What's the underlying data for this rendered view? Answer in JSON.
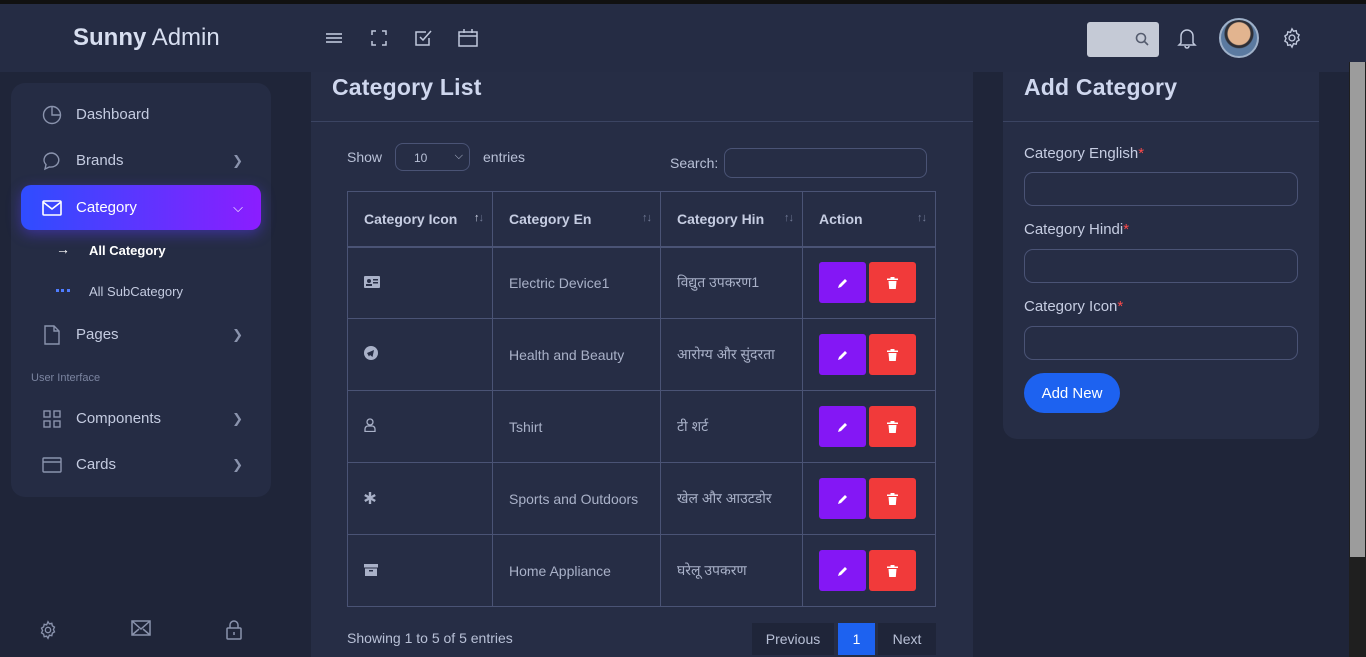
{
  "header": {
    "brand_bold": "Sunny",
    "brand_rest": "Admin"
  },
  "sidebar": {
    "items": [
      {
        "label": "Dashboard",
        "icon": "pie-chart-icon"
      },
      {
        "label": "Brands",
        "icon": "chat-icon"
      },
      {
        "label": "Category",
        "icon": "mail-icon"
      },
      {
        "label": "Pages",
        "icon": "file-icon"
      },
      {
        "label": "Components",
        "icon": "grid-icon"
      },
      {
        "label": "Cards",
        "icon": "card-icon"
      }
    ],
    "sub_items": [
      "All Category",
      "All SubCategory"
    ],
    "caption": "User Interface"
  },
  "list_panel": {
    "title": "Category List",
    "show_label": "Show",
    "entries_value": "10",
    "entries_label": "entries",
    "search_label": "Search:",
    "columns": [
      "Category Icon",
      "Category En",
      "Category Hin",
      "Action"
    ],
    "rows": [
      {
        "icon": "id-card-icon",
        "en": "Electric Device1",
        "hin": "विद्युत उपकरण1"
      },
      {
        "icon": "telegram-icon",
        "en": "Health and Beauty",
        "hin": "आरोग्य और सुंदरता"
      },
      {
        "icon": "user-icon",
        "en": "Tshirt",
        "hin": "टी शर्ट"
      },
      {
        "icon": "asterisk-icon",
        "en": "Sports and Outdoors",
        "hin": "खेल और आउटडोर"
      },
      {
        "icon": "archive-icon",
        "en": "Home Appliance",
        "hin": "घरेलू उपकरण"
      }
    ],
    "info": "Showing 1 to 5 of 5 entries",
    "pager": {
      "prev": "Previous",
      "current": "1",
      "next": "Next"
    }
  },
  "form_panel": {
    "title": "Add Category",
    "fields": [
      "Category English",
      "Category Hindi",
      "Category Icon"
    ],
    "required_mark": "*",
    "submit": "Add New"
  },
  "colors": {
    "accent_start": "#2f4dff",
    "accent_end": "#8b1dff",
    "edit": "#8417f5",
    "delete": "#f13a3a",
    "primary": "#1d62f0"
  }
}
